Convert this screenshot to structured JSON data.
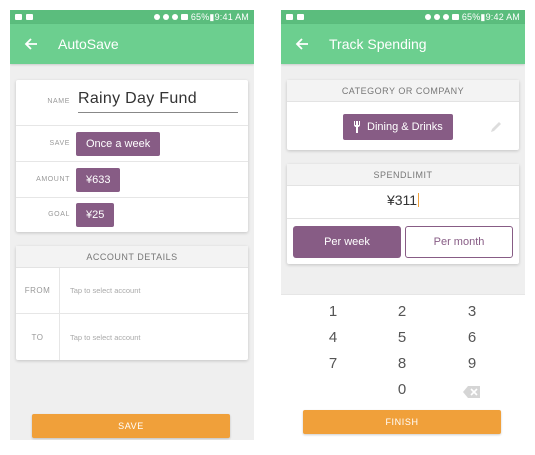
{
  "left": {
    "status": {
      "left_icons": [
        "key-icon",
        "image-icon"
      ],
      "right_text": "65%▮9:41 AM",
      "extra_icons": [
        "alarm-icon",
        "bluetooth-icon",
        "mute-icon",
        "signal-icon"
      ]
    },
    "appbar": {
      "title": "AutoSave"
    },
    "form": {
      "name_label": "NAME",
      "name_value": "Rainy Day Fund",
      "save_label": "SAVE",
      "save_value": "Once a week",
      "amount_label": "AMOUNT",
      "amount_value": "¥633",
      "goal_label": "GOAL",
      "goal_value": "¥25"
    },
    "account": {
      "header": "ACCOUNT DETAILS",
      "from_label": "FROM",
      "from_placeholder": "Tap to select account",
      "to_label": "TO",
      "to_placeholder": "Tap to select account"
    },
    "save_button": "SAVE"
  },
  "right": {
    "status": {
      "left_icons": [
        "image-icon",
        "key-icon"
      ],
      "right_text": "65%▮9:42 AM"
    },
    "appbar": {
      "title": "Track Spending"
    },
    "category": {
      "header": "CATEGORY OR COMPANY",
      "chip": "Dining & Drinks"
    },
    "spend": {
      "header": "SPENDLIMIT",
      "value": "¥311",
      "per_week": "Per week",
      "per_month": "Per month"
    },
    "keypad": {
      "keys": [
        "1",
        "2",
        "3",
        "4",
        "5",
        "6",
        "7",
        "8",
        "9",
        "0"
      ]
    },
    "finish_button": "FINISH"
  },
  "colors": {
    "appbar": "#6ccf8f",
    "statusbar": "#5bbd7d",
    "chip": "#875c85",
    "orange": "#f0a03a"
  }
}
